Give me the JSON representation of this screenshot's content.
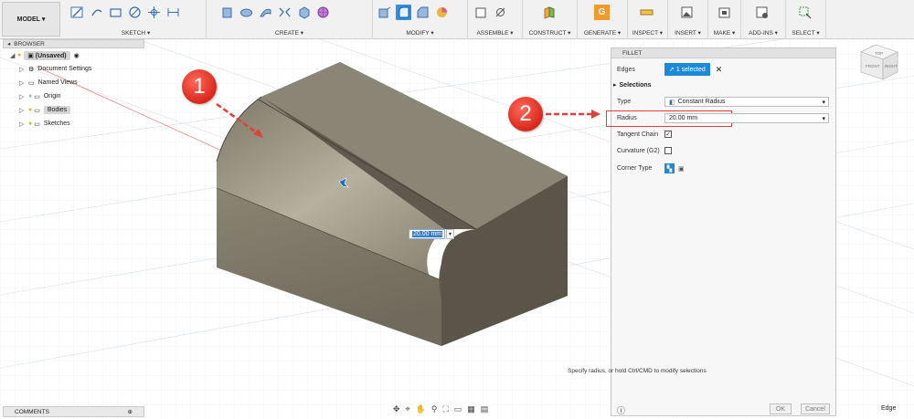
{
  "toolbar": {
    "workspace": "MODEL",
    "groups": [
      "SKETCH",
      "CREATE",
      "MODIFY",
      "ASSEMBLE",
      "CONSTRUCT",
      "GENERATE",
      "INSPECT",
      "INSERT",
      "MAKE",
      "ADD-INS",
      "SELECT"
    ]
  },
  "browser": {
    "title": "BROWSER",
    "root": "(Unsaved)",
    "items": [
      "Document Settings",
      "Named Views",
      "Origin",
      "Bodies",
      "Sketches"
    ]
  },
  "comments": {
    "title": "COMMENTS"
  },
  "viewcube": {
    "front": "FRONT",
    "right": "RIGHT",
    "top": "TOP"
  },
  "viewport": {
    "dimension_value": "20.00 mm",
    "marker_1": "1",
    "marker_2": "2"
  },
  "fillet": {
    "title": "FILLET",
    "edges_label": "Edges",
    "edges_value": "1 selected",
    "section": "Selections",
    "type_label": "Type",
    "type_value": "Constant Radius",
    "radius_label": "Radius",
    "radius_value": "20.00 mm",
    "tangent_label": "Tangent Chain",
    "curvature_label": "Curvature (G2)",
    "corner_label": "Corner Type",
    "ok": "OK",
    "cancel": "Cancel"
  },
  "hint": "Specify radius, or hold Ctrl/CMD to modify selections",
  "status": "Edge",
  "colors": {
    "accent": "#1d8ad9",
    "marker": "#d8271b",
    "highlight": "#e0403a"
  }
}
